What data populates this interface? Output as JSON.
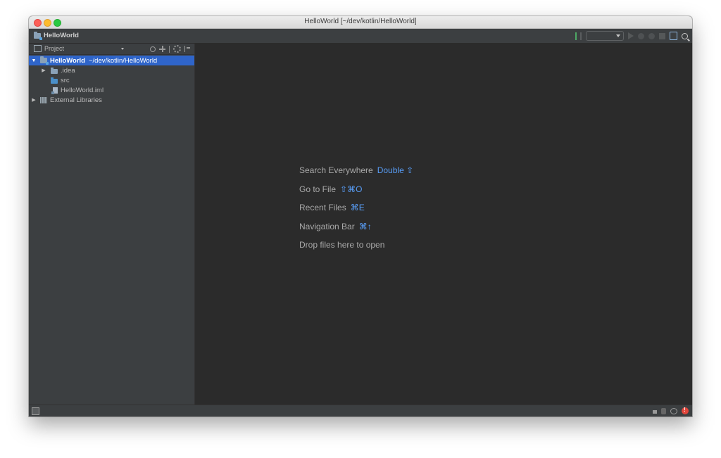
{
  "window": {
    "title": "HelloWorld [~/dev/kotlin/HelloWorld]"
  },
  "navbar": {
    "project_name": "HelloWorld",
    "tools": [
      "build-icon",
      "run-configuration-dropdown",
      "run-icon",
      "debug-icon",
      "coverage-icon",
      "stop-icon",
      "project-structure-icon",
      "search-icon"
    ]
  },
  "project_panel": {
    "title": "Project",
    "actions": [
      "sync-icon",
      "scroll-from-source-icon",
      "gear-icon",
      "hide-icon"
    ],
    "tree": {
      "root_name": "HelloWorld",
      "root_path": "~/dev/kotlin/HelloWorld",
      "children": [
        ".idea",
        "src",
        "HelloWorld.iml"
      ],
      "external": "External Libraries"
    }
  },
  "editor": {
    "hints": [
      {
        "label": "Search Everywhere",
        "shortcut": "Double ⇧"
      },
      {
        "label": "Go to File",
        "shortcut": "⇧⌘O"
      },
      {
        "label": "Recent Files",
        "shortcut": "⌘E"
      },
      {
        "label": "Navigation Bar",
        "shortcut": "⌘↑"
      },
      {
        "label": "Drop files here to open",
        "shortcut": ""
      }
    ]
  },
  "colors": {
    "selection": "#2f65ca",
    "shortcut": "#589df6",
    "error": "#e0453b"
  }
}
